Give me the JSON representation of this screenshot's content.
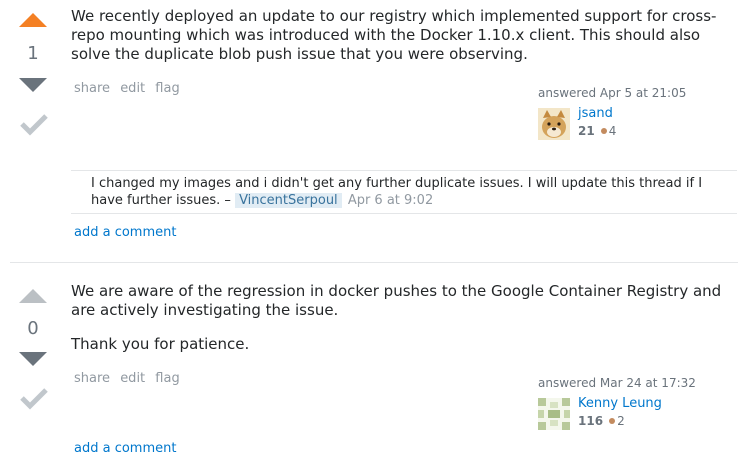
{
  "answers": [
    {
      "votes": "1",
      "text": "We recently deployed an update to our registry which implemented support for cross-repo mounting which was introduced with the Docker 1.10.x client. This should also solve the duplicate blob push issue that you were observing.",
      "menu": {
        "share": "share",
        "edit": "edit",
        "flag": "flag"
      },
      "answered": "answered Apr 5 at 21:05",
      "user": "jsand",
      "rep": "21",
      "bronze": "4",
      "comment": {
        "text": "I changed my images and i didn't get any further duplicate issues. I will update this thread if I have further issues. –",
        "user": "VincentSerpoul",
        "time": "Apr 6 at 9:02"
      },
      "add_comment": "add a comment"
    },
    {
      "votes": "0",
      "paragraphs": [
        "We are aware of the regression in docker pushes to the Google Container Registry and are actively investigating the issue.",
        "Thank you for patience."
      ],
      "menu": {
        "share": "share",
        "edit": "edit",
        "flag": "flag"
      },
      "answered": "answered Mar 24 at 17:32",
      "user": "Kenny Leung",
      "rep": "116",
      "bronze": "2",
      "add_comment": "add a comment"
    }
  ]
}
